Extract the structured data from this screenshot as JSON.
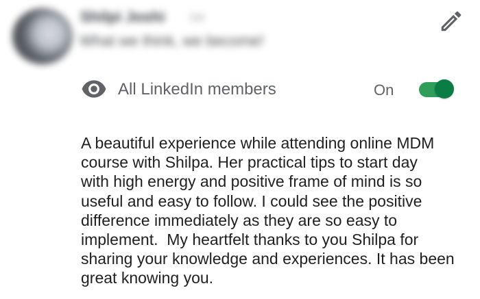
{
  "recommendation": {
    "author": {
      "name": "Shilpi Joshi",
      "degree": "1st",
      "headline": "What we think, we become!"
    },
    "edit": {
      "icon": "pencil-icon"
    },
    "visibility": {
      "icon": "eye-icon",
      "label": "All LinkedIn members",
      "state_label": "On",
      "enabled": true,
      "accent_color": "#0a7d45"
    },
    "text": "A beautiful experience while attending online MDM\ncourse with Shilpa. Her practical tips to start day\nwith high energy and positive frame of mind is so\nuseful and easy to follow. I could see the positive\ndifference immediately as they are so easy to\nimplement.  My heartfelt thanks to you Shilpa for\nsharing your knowledge and experiences. It has been\ngreat knowing you."
  }
}
